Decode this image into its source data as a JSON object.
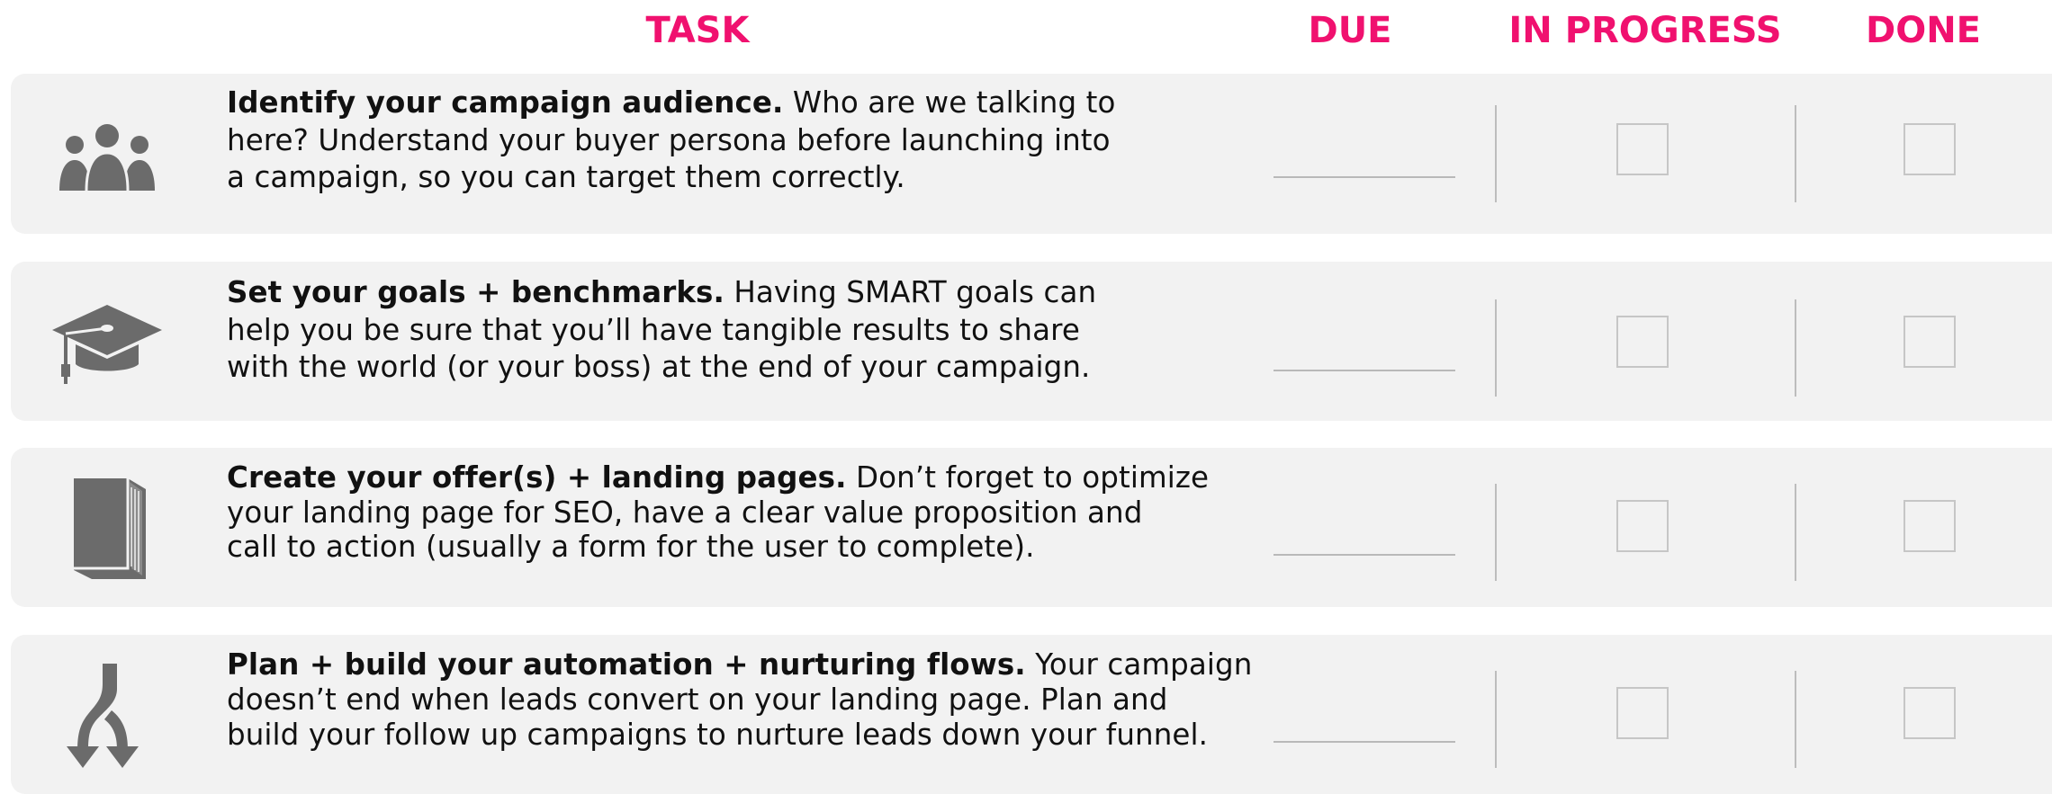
{
  "headers": {
    "task": "TASK",
    "due": "DUE",
    "in_progress": "IN PROGRESS",
    "done": "DONE"
  },
  "colors": {
    "accent": "#f0116f",
    "row_background": "#f2f2f2",
    "icon": "#6b6b6b"
  },
  "tasks": [
    {
      "icon": "people-icon",
      "title": "Identify your campaign audience.",
      "line1": " Who are we talking to",
      "line2": "here? Understand your buyer persona before launching into",
      "line3": "a campaign, so you can target them correctly."
    },
    {
      "icon": "graduation-cap-icon",
      "title": "Set your goals + benchmarks.",
      "line1": " Having SMART goals can",
      "line2": "help you be sure that you’ll have tangible results to share",
      "line3": "with the world (or your boss) at the end of your campaign."
    },
    {
      "icon": "book-icon",
      "title": "Create your offer(s) + landing pages.",
      "line1": " Don’t forget to optimize",
      "line2": "your landing page for SEO, have a clear value proposition and",
      "line3": "call to action (usually a form for the user to complete)."
    },
    {
      "icon": "split-arrows-icon",
      "title": "Plan + build your automation + nurturing flows.",
      "line1": " Your campaign",
      "line2": "doesn’t end when leads convert on your landing page. Plan and",
      "line3": "build your follow up campaigns to nurture leads down your funnel."
    }
  ]
}
